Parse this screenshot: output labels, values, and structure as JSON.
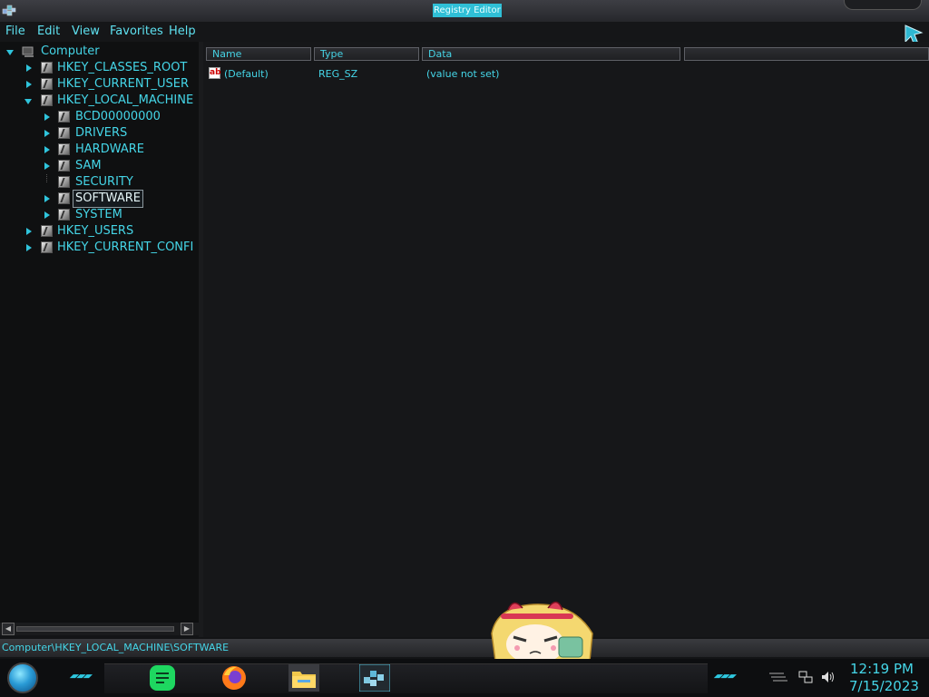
{
  "window": {
    "title": "Registry Editor"
  },
  "menu": {
    "file": "File",
    "edit": "Edit",
    "view": "View",
    "favorites": "Favorites",
    "help": "Help"
  },
  "tree": {
    "root": "Computer",
    "hives": {
      "classes_root": "HKEY_CLASSES_ROOT",
      "current_user": "HKEY_CURRENT_USER",
      "local_machine": "HKEY_LOCAL_MACHINE",
      "users": "HKEY_USERS",
      "current_config": "HKEY_CURRENT_CONFI"
    },
    "local_machine_children": [
      "BCD00000000",
      "DRIVERS",
      "HARDWARE",
      "SAM",
      "SECURITY",
      "SOFTWARE",
      "SYSTEM"
    ],
    "selected": "SOFTWARE"
  },
  "list": {
    "columns": [
      "Name",
      "Type",
      "Data"
    ],
    "rows": [
      {
        "name": "(Default)",
        "type": "REG_SZ",
        "data": "(value not set)",
        "icon": "string-value-icon"
      }
    ]
  },
  "status": {
    "path": "Computer\\HKEY_LOCAL_MACHINE\\SOFTWARE"
  },
  "taskbar": {
    "apps": [
      "spotify-icon",
      "firefox-icon",
      "file-explorer-icon",
      "registry-editor-icon"
    ],
    "time": "12:19 PM",
    "date": "7/15/2023"
  },
  "colors": {
    "accent": "#45d6e8",
    "background": "#131416",
    "title_highlight": "#2fbfd6"
  }
}
